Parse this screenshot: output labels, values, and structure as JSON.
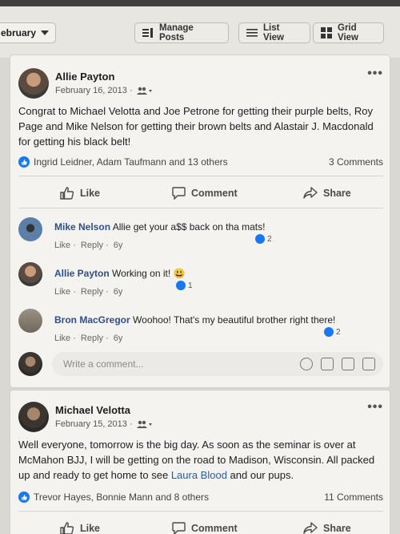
{
  "toolbar": {
    "month": "ebruary",
    "manage_posts": "Manage Posts",
    "list_view": "List View",
    "grid_view": "Grid View"
  },
  "post1": {
    "author": "Allie Payton",
    "date": "February 16, 2013 ·",
    "text": "Congrat to Michael Velotta and Joe Petrone for getting their purple belts, Roy Page and Mike Nelson for getting their brown belts and Alastair J. Macdonald for getting his black belt!",
    "reactions": "Ingrid Leidner, Adam Taufmann and 13 others",
    "comments_count": "3 Comments",
    "actions": {
      "like": "Like",
      "comment": "Comment",
      "share": "Share"
    },
    "comments": [
      {
        "name": "Mike Nelson",
        "text": "Allie get your a$$ back on tha mats!",
        "like": "Like",
        "reply": "Reply",
        "age": "6y",
        "count": "2"
      },
      {
        "name": "Allie Payton",
        "text": "Working on it! 😃",
        "like": "Like",
        "reply": "Reply",
        "age": "6y",
        "count": "1"
      },
      {
        "name": "Bron MacGregor",
        "text": "Woohoo! That's my beautiful brother right there!",
        "like": "Like",
        "reply": "Reply",
        "age": "6y",
        "count": "2"
      }
    ],
    "write_placeholder": "Write a comment..."
  },
  "post2": {
    "author": "Michael Velotta",
    "date": "February 15, 2013 ·",
    "text_before": "Well everyone, tomorrow is the big day. As soon as the seminar is over at McMahon BJJ, I will be getting on the road to Madison, Wisconsin. All packed up and ready to get home to see ",
    "text_link": "Laura Blood",
    "text_after": " and our pups.",
    "reactions": "Trevor Hayes, Bonnie Mann and 8 others",
    "comments_count": "11 Comments",
    "actions": {
      "like": "Like",
      "comment": "Comment",
      "share": "Share"
    }
  },
  "colors": {
    "accent": "#1877f2",
    "name_link": "#2d4f8e"
  }
}
